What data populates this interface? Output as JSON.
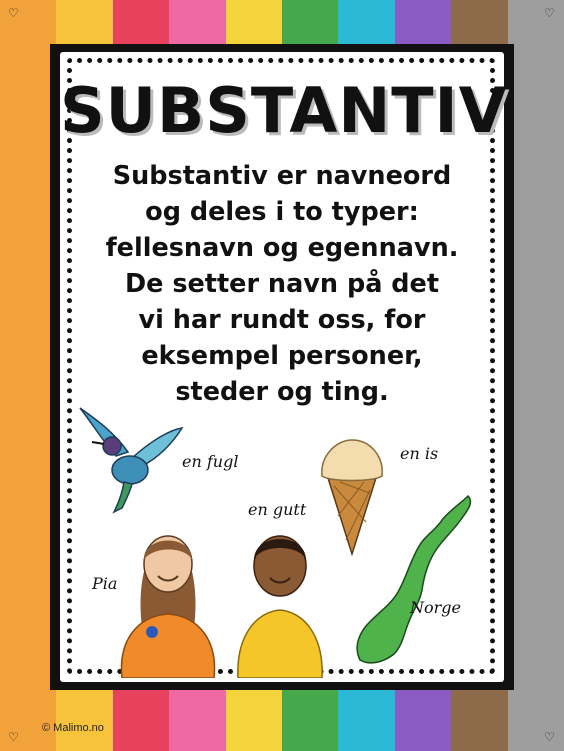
{
  "poster": {
    "title": "SUBSTANTIV",
    "lines": [
      "Substantiv er navneord",
      "og deles i to typer:",
      "fellesnavn og egennavn.",
      "De setter navn på det",
      "vi har rundt oss, for",
      "eksempel personer,",
      "steder og ting."
    ]
  },
  "labels": {
    "bird": "en fugl",
    "icecream": "en is",
    "boy": "en gutt",
    "girl": "Pia",
    "norway": "Norge"
  },
  "footer": {
    "copyright": "© Malimo.no"
  },
  "colors": {
    "stripes": [
      "#f2a23a",
      "#f7c33a",
      "#e8415d",
      "#ef6aa3",
      "#f5d33a",
      "#45a84a",
      "#2cb9d6",
      "#8a5cc3",
      "#8c6a4a",
      "#9e9e9e"
    ],
    "frame": "#111111"
  },
  "icons": [
    "heart-icon",
    "hummingbird-illustration",
    "ice-cream-illustration",
    "girl-illustration",
    "boy-illustration",
    "norway-map-illustration"
  ]
}
